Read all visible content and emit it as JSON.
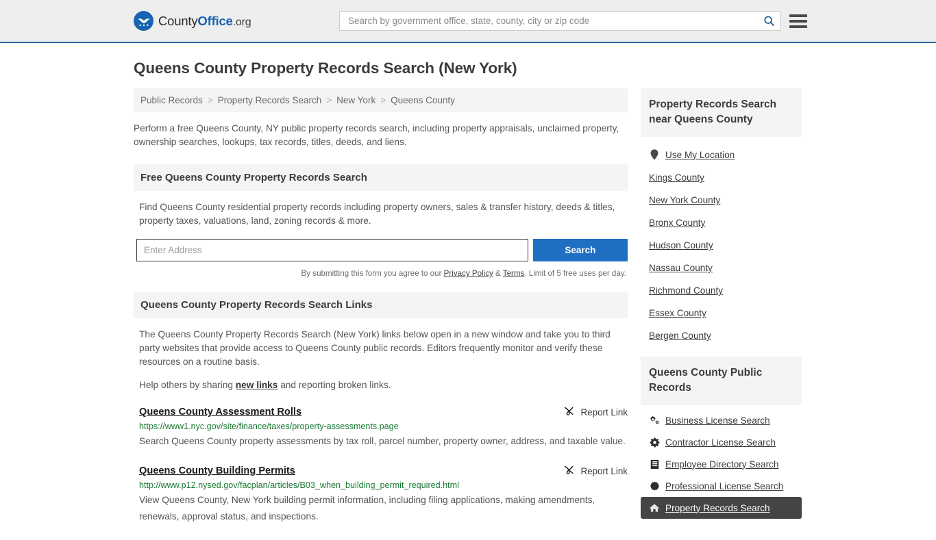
{
  "header": {
    "logo": {
      "part1": "County",
      "part2": "Office",
      "tld": ".org",
      "icon": "eagle-shield-logo"
    },
    "search": {
      "placeholder": "Search by government office, state, county, city or zip code",
      "value": "",
      "icon": "search-icon"
    },
    "menu_icon": "hamburger-menu-icon",
    "accent_color": "#2c6ca3"
  },
  "page": {
    "title": "Queens County Property Records Search (New York)",
    "breadcrumb": [
      {
        "label": "Public Records"
      },
      {
        "label": "Property Records Search"
      },
      {
        "label": "New York"
      },
      {
        "label": "Queens County"
      }
    ],
    "breadcrumb_separator": ">",
    "lede": "Perform a free Queens County, NY public property records search, including property appraisals, unclaimed property, ownership searches, lookups, tax records, titles, deeds, and liens."
  },
  "free_search": {
    "heading": "Free Queens County Property Records Search",
    "body": "Find Queens County residential property records including property owners, sales & transfer history, deeds & titles, property taxes, valuations, land, zoning records & more.",
    "input_placeholder": "Enter Address",
    "input_value": "",
    "button_label": "Search",
    "button_color": "#1f6fc4",
    "disclaimer_prefix": "By submitting this form you agree to our ",
    "disclaimer_privacy": "Privacy Policy",
    "disclaimer_amp": " & ",
    "disclaimer_terms": "Terms",
    "disclaimer_suffix": ". Limit of 5 free uses per day."
  },
  "links_section": {
    "heading": "Queens County Property Records Search Links",
    "paragraph": "The Queens County Property Records Search (New York) links below open in a new window and take you to third party websites that provide access to Queens County public records. Editors frequently monitor and verify these resources on a routine basis.",
    "help_prefix": "Help others by sharing ",
    "help_link": "new links",
    "help_suffix": " and reporting broken links.",
    "report_label": "Report Link",
    "report_icon": "unlink-icon",
    "items": [
      {
        "title": "Queens County Assessment Rolls",
        "url": "https://www1.nyc.gov/site/finance/taxes/property-assessments.page",
        "description": "Search Queens County property assessments by tax roll, parcel number, property owner, address, and taxable value."
      },
      {
        "title": "Queens County Building Permits",
        "url": "http://www.p12.nysed.gov/facplan/articles/B03_when_building_permit_required.html",
        "description": "View Queens County, New York building permit information, including filing applications, making amendments, renewals, approval status, and inspections."
      }
    ]
  },
  "sidebar": {
    "nearby": {
      "heading": "Property Records Search near Queens County",
      "items": [
        {
          "label": "Use My Location",
          "icon": "map-pin-icon"
        },
        {
          "label": "Kings County",
          "icon": ""
        },
        {
          "label": "New York County",
          "icon": ""
        },
        {
          "label": "Bronx County",
          "icon": ""
        },
        {
          "label": "Hudson County",
          "icon": ""
        },
        {
          "label": "Nassau County",
          "icon": ""
        },
        {
          "label": "Richmond County",
          "icon": ""
        },
        {
          "label": "Essex County",
          "icon": ""
        },
        {
          "label": "Bergen County",
          "icon": ""
        }
      ]
    },
    "public_records": {
      "heading": "Queens County Public Records",
      "items": [
        {
          "label": "Business License Search",
          "icon": "cogs-icon",
          "active": false
        },
        {
          "label": "Contractor License Search",
          "icon": "cog-icon",
          "active": false
        },
        {
          "label": "Employee Directory Search",
          "icon": "id-card-icon",
          "active": false
        },
        {
          "label": "Professional License Search",
          "icon": "certificate-icon",
          "active": false
        },
        {
          "label": "Property Records Search",
          "icon": "home-icon",
          "active": true
        }
      ],
      "active_bg": "#444444"
    }
  }
}
